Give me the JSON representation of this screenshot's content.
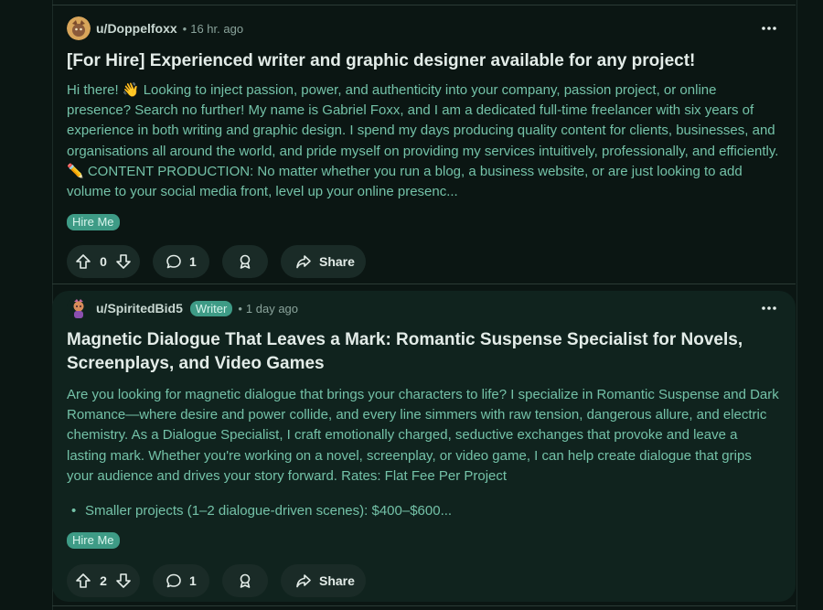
{
  "posts": [
    {
      "username": "u/Doppelfoxx",
      "time": "16 hr. ago",
      "title": "[For Hire] Experienced writer and graphic designer available for any project!",
      "body": "Hi there! 👋 Looking to inject passion, power, and authenticity into your company, passion project, or online presence? Search no further! My name is Gabriel Foxx, and I am a dedicated full-time freelancer with six years of experience in both writing and graphic design. I spend my days producing quality content for clients, businesses, and organisations all around the world, and pride myself on providing my services intuitively, professionally, and efficiently. ✏️ CONTENT PRODUCTION: No matter whether you run a blog, a business website, or are just looking to add volume to your social media front, level up your online presenc...",
      "tag": "Hire Me",
      "votes": "0",
      "comments": "1",
      "share_label": "Share"
    },
    {
      "username": "u/SpiritedBid5",
      "user_flair": "Writer",
      "time": "1 day ago",
      "title": "Magnetic Dialogue That Leaves a Mark: Romantic Suspense Specialist for Novels, Screenplays, and Video Games",
      "body": "Are you looking for magnetic dialogue that brings your characters to life? I specialize in Romantic Suspense and Dark Romance—where desire and power collide, and every line simmers with raw tension, dangerous allure, and electric chemistry. As a Dialogue Specialist, I craft emotionally charged, seductive exchanges that provoke and leave a lasting mark. Whether you're working on a novel, screenplay, or video game, I can help create dialogue that grips your audience and drives your story forward. Rates: Flat Fee Per Project",
      "bullet": "Smaller projects (1–2 dialogue-driven scenes): $400–$600...",
      "tag": "Hire Me",
      "votes": "2",
      "comments": "1",
      "share_label": "Share"
    }
  ],
  "colors": {
    "background": "#0b1613",
    "highlight_card": "#10231e",
    "flair_bg": "#3e9b86",
    "body_text": "#74c2a8"
  },
  "icons": [
    "upvote-icon",
    "downvote-icon",
    "comment-icon",
    "award-icon",
    "share-icon",
    "more-options-icon"
  ]
}
